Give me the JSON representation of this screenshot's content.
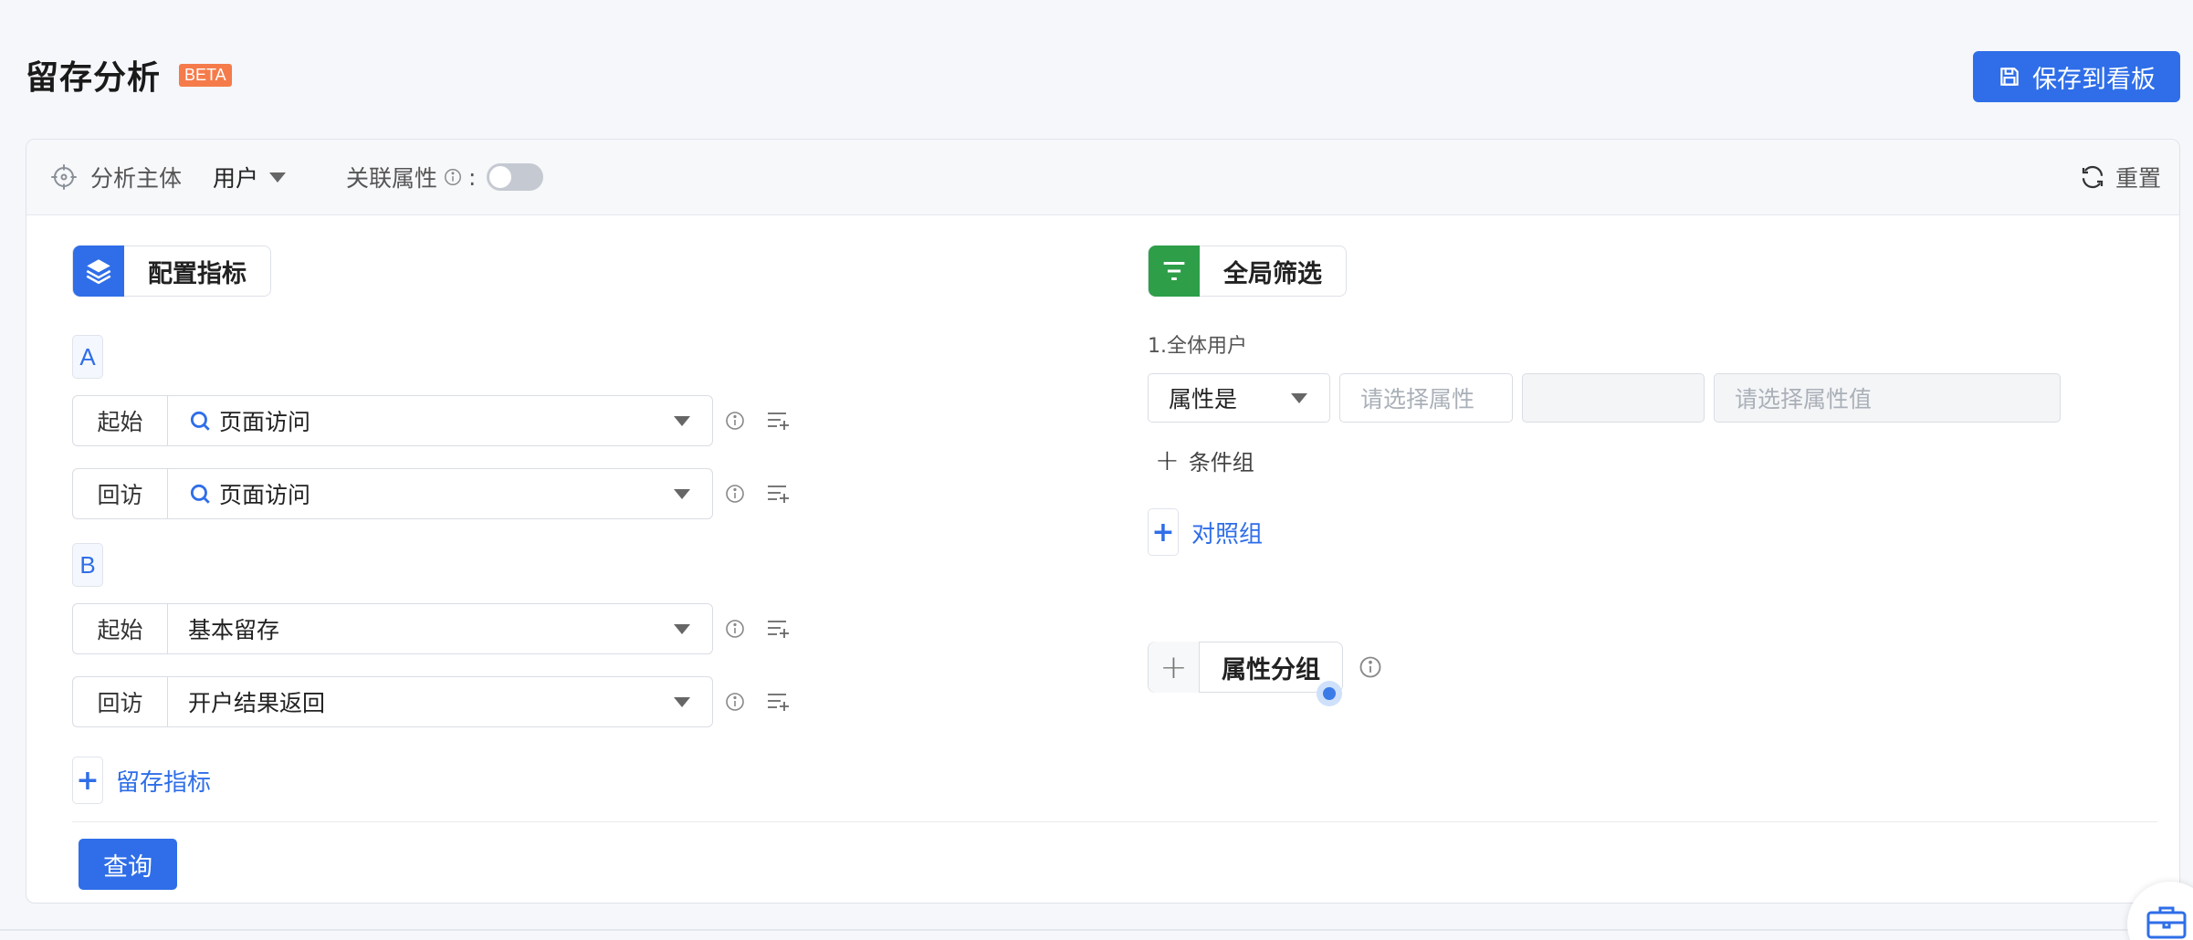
{
  "header": {
    "title": "留存分析",
    "badge": "BETA",
    "save_label": "保存到看板"
  },
  "toolbar": {
    "subject_label": "分析主体",
    "subject_value": "用户",
    "assoc_label": "关联属性",
    "assoc_colon": ":",
    "assoc_enabled": false,
    "reset_label": "重置"
  },
  "metrics": {
    "section_label": "配置指标",
    "groups": [
      {
        "tag": "A",
        "rows": [
          {
            "label": "起始",
            "value": "页面访问",
            "has_search_icon": true
          },
          {
            "label": "回访",
            "value": "页面访问",
            "has_search_icon": true
          }
        ]
      },
      {
        "tag": "B",
        "rows": [
          {
            "label": "起始",
            "value": "基本留存",
            "has_search_icon": false
          },
          {
            "label": "回访",
            "value": "开户结果返回",
            "has_search_icon": false
          }
        ]
      }
    ],
    "add_label": "留存指标",
    "query_label": "查询"
  },
  "filter": {
    "section_label": "全局筛选",
    "group_title": "1.全体用户",
    "attr_op": "属性是",
    "attr_placeholder": "请选择属性",
    "value_placeholder": "请选择属性值",
    "cond_label": "条件组",
    "compare_label": "对照组",
    "attr_group_label": "属性分组"
  },
  "colors": {
    "accent": "#2f6ee8",
    "badge": "#f57b4a",
    "filter_icon": "#2e9e48"
  }
}
